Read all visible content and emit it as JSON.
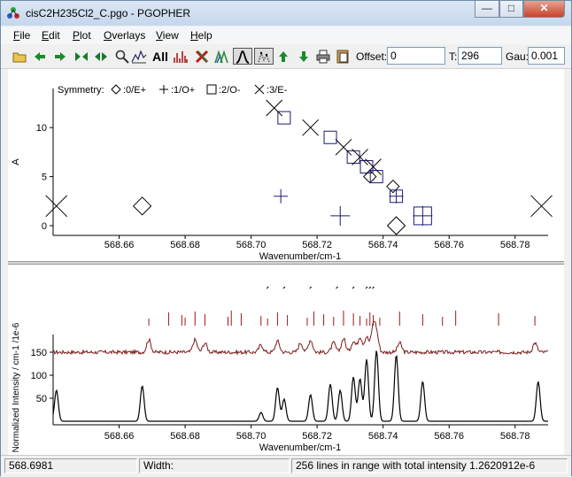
{
  "window": {
    "title": "cisC2H235Cl2_C.pgo - PGOPHER",
    "minimize": "—",
    "maximize": "□",
    "close": "✕"
  },
  "menu": [
    {
      "label": "File",
      "u": "F",
      "rest": "ile"
    },
    {
      "label": "Edit",
      "u": "E",
      "rest": "dit"
    },
    {
      "label": "Plot",
      "u": "P",
      "rest": "lot"
    },
    {
      "label": "Overlays",
      "u": "O",
      "rest": "verlays"
    },
    {
      "label": "View",
      "u": "V",
      "rest": "iew"
    },
    {
      "label": "Help",
      "u": "H",
      "rest": "elp"
    }
  ],
  "toolbar": {
    "all_label": "All",
    "offset_label": "Offset:",
    "offset_value": "0",
    "t_label": "T:",
    "t_value": "296",
    "gau_label": "Gau:",
    "gau_value": "0.001",
    "tools": [
      "open-icon",
      "back-icon",
      "forward-icon",
      "first-icon",
      "last-icon",
      "zoom-icon",
      "fit-icon",
      "all-button",
      "spectrum-icon",
      "clear-icon",
      "simulate-icon",
      "line-shape-icon",
      "sticks-icon",
      "up-icon",
      "down-icon",
      "print-icon",
      "copy-icon"
    ]
  },
  "chart_data": [
    {
      "type": "scatter",
      "title": "",
      "xlabel": "Wavenumber/cm-1",
      "ylabel": "A",
      "xlim": [
        568.64,
        568.79
      ],
      "ylim": [
        0,
        12
      ],
      "x_ticks": [
        "568.66",
        "568.68",
        "568.70",
        "568.72",
        "568.74",
        "568.76",
        "568.78"
      ],
      "y_ticks": [
        "0",
        "5",
        "10"
      ],
      "legend_title": "Symmetry:",
      "legend": [
        "0/E+",
        "1/O+",
        "2/O-",
        "3/E-"
      ],
      "series": [
        {
          "name": "0/E+",
          "marker": "diamond",
          "points": [
            [
              568.667,
              2
            ],
            [
              568.743,
              4
            ],
            [
              568.736,
              5
            ],
            [
              568.744,
              0
            ]
          ]
        },
        {
          "name": "1/O+",
          "marker": "plus",
          "points": [
            [
              568.709,
              3
            ],
            [
              568.727,
              1
            ],
            [
              568.744,
              3
            ],
            [
              568.752,
              1
            ]
          ]
        },
        {
          "name": "2/O-",
          "marker": "square",
          "points": [
            [
              568.71,
              11
            ],
            [
              568.724,
              9
            ],
            [
              568.731,
              7
            ],
            [
              568.735,
              6
            ],
            [
              568.738,
              5
            ],
            [
              568.744,
              3
            ],
            [
              568.752,
              1
            ]
          ]
        },
        {
          "name": "3/E-",
          "marker": "x",
          "points": [
            [
              568.641,
              2
            ],
            [
              568.788,
              2
            ],
            [
              568.707,
              12
            ],
            [
              568.718,
              10
            ],
            [
              568.728,
              8
            ],
            [
              568.733,
              7
            ],
            [
              568.737,
              6
            ]
          ]
        }
      ]
    },
    {
      "type": "line",
      "title": "",
      "xlabel": "Wavenumber/cm-1",
      "ylabel": "Normalized Intensity / cm-1 /1e-6",
      "xlim": [
        568.64,
        568.79
      ],
      "ylim": [
        0,
        180
      ],
      "x_ticks": [
        "568.66",
        "568.68",
        "568.70",
        "568.72",
        "568.74",
        "568.76",
        "568.78"
      ],
      "y_ticks": [
        "50",
        "100",
        "150"
      ],
      "series": [
        {
          "name": "",
          "color": "#000000",
          "peaks": [
            [
              568.641,
              35
            ],
            [
              568.667,
              40
            ],
            [
              568.703,
              10
            ],
            [
              568.708,
              38
            ],
            [
              568.71,
              25
            ],
            [
              568.718,
              30
            ],
            [
              568.724,
              42
            ],
            [
              568.727,
              35
            ],
            [
              568.731,
              50
            ],
            [
              568.733,
              48
            ],
            [
              568.735,
              70
            ],
            [
              568.738,
              80
            ],
            [
              568.744,
              75
            ],
            [
              568.752,
              45
            ],
            [
              568.787,
              45
            ]
          ]
        }
      ],
      "observed_peaks": [
        [
          568.669,
          20
        ],
        [
          568.683,
          20
        ],
        [
          568.686,
          15
        ],
        [
          568.703,
          12
        ],
        [
          568.708,
          18
        ],
        [
          568.715,
          15
        ],
        [
          568.718,
          20
        ],
        [
          568.725,
          15
        ],
        [
          568.728,
          22
        ],
        [
          568.731,
          18
        ],
        [
          568.733,
          25
        ],
        [
          568.735,
          25
        ],
        [
          568.737,
          40
        ],
        [
          568.738,
          28
        ],
        [
          568.745,
          15
        ],
        [
          568.786,
          15
        ]
      ],
      "stick_positions": [
        568.669,
        568.675,
        568.679,
        568.68,
        568.683,
        568.686,
        568.693,
        568.694,
        568.697,
        568.703,
        568.705,
        568.708,
        568.711,
        568.717,
        568.719,
        568.722,
        568.725,
        568.728,
        568.731,
        568.733,
        568.735,
        568.736,
        568.737,
        568.739,
        568.745,
        568.752,
        568.758,
        568.762,
        568.775,
        568.786
      ]
    }
  ],
  "status": {
    "position": "568.6981",
    "width_label": "Width:",
    "message": "256 lines in range with total intensity 1.2620912e-6"
  }
}
